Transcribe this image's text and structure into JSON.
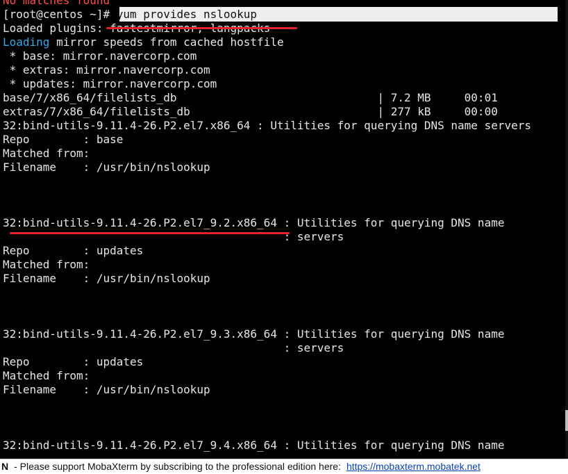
{
  "terminal": {
    "line0": "No matches found",
    "prompt": "[root@centos ~]# ",
    "command": "yum provides nslookup",
    "line2": "Loaded plugins: fastestmirror, langpacks",
    "line3_cyan": "Loading",
    "line3_rest": " mirror speeds from cached hostfile",
    "line4": " * base: mirror.navercorp.com",
    "line5": " * extras: mirror.navercorp.com",
    "line6": " * updates: mirror.navercorp.com",
    "line7": "base/7/x86_64/filelists_db                              | 7.2 MB     00:01",
    "line8": "extras/7/x86_64/filelists_db                            | 277 kB     00:00",
    "line9": "32:bind-utils-9.11.4-26.P2.el7.x86_64 : Utilities for querying DNS name servers",
    "line10": "Repo        : base",
    "line11": "Matched from:",
    "line12": "Filename    : /usr/bin/nslookup",
    "line16": "32:bind-utils-9.11.4-26.P2.el7_9.2.x86_64 : Utilities for querying DNS name",
    "line17": "                                          : servers",
    "line18": "Repo        : updates",
    "line19": "Matched from:",
    "line20": "Filename    : /usr/bin/nslookup",
    "line24": "32:bind-utils-9.11.4-26.P2.el7_9.3.x86_64 : Utilities for querying DNS name",
    "line25": "                                          : servers",
    "line26": "Repo        : updates",
    "line27": "Matched from:",
    "line28": "Filename    : /usr/bin/nslookup",
    "line32": "32:bind-utils-9.11.4-26.P2.el7_9.4.x86_64 : Utilities for querying DNS name"
  },
  "statusbar": {
    "prefix": "N",
    "message": "-  Please support MobaXterm by subscribing to the professional edition here:",
    "link": "https://mobaxterm.mobatek.net"
  },
  "colors": {
    "error": "#ff4b4b",
    "info": "#35a9e8",
    "annotation": "#e8202a",
    "command_highlight": "#efefef"
  }
}
